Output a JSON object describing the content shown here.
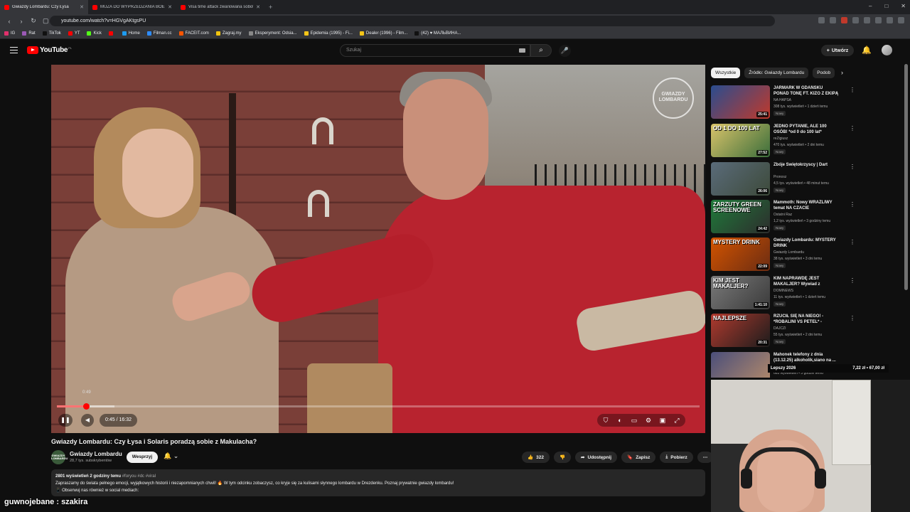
{
  "browser": {
    "tabs": [
      {
        "title": "Gwiazdy Lombardu: Czy Łysa",
        "active": true
      },
      {
        "title": "MUZA DO WYPRZEDZANIA BOEING",
        "active": false
      },
      {
        "title": "Visa time attack zwariowana sobota",
        "active": false
      }
    ],
    "new_tab": "+",
    "window_controls": [
      "–",
      "□",
      "✕"
    ],
    "url": "youtube.com/watch?v=HGVgAKtgsPU",
    "bookmarks": [
      {
        "label": "IG",
        "color": "#e1306c"
      },
      {
        "label": "Rat",
        "color": "#9b59b6"
      },
      {
        "label": "TikTok",
        "color": "#111111"
      },
      {
        "label": "YT",
        "color": "#ff0000"
      },
      {
        "label": "Kick",
        "color": "#53fc18"
      },
      {
        "label": "",
        "color": "#ff0000"
      },
      {
        "label": "Home",
        "color": "#1d9bf0"
      },
      {
        "label": "Filman.cc",
        "color": "#2d8cff"
      },
      {
        "label": "FACEIT.com",
        "color": "#ff5500"
      },
      {
        "label": "Zagraj.my",
        "color": "#f1c40f"
      },
      {
        "label": "Eksperyment: Odsia...",
        "color": "#888888"
      },
      {
        "label": "Epidemia (1995) - Fi...",
        "color": "#f5c518"
      },
      {
        "label": "Dealer (1996) - Film...",
        "color": "#f5c518"
      },
      {
        "label": "(42) ♥ МАЛЬВИНА...",
        "color": "#111111"
      }
    ]
  },
  "youtube": {
    "logo": "YouTube",
    "country": "PL",
    "search_placeholder": "Szukaj",
    "create_label": "Utwórz"
  },
  "video": {
    "watermark": "GWIAZDY LOMBARDU",
    "hover_time": "0:49",
    "time": "0:45 / 16:32",
    "progress_fraction": 0.045,
    "buffer_fraction": 0.09,
    "title": "Gwiazdy Lombardu: Czy Łysa i Solaris poradzą sobie z Makulacha?",
    "channel": "Gwiazdy Lombardu",
    "channel_avatar_text": "GWIAZDY LOMBARDU",
    "subs": "28,7 tys. subskrybentów",
    "support_label": "Wesprzyj",
    "likes": "322",
    "share_label": "Udostępnij",
    "save_label": "Zapisz",
    "download_label": "Pobierz",
    "desc_stats": "2801 wyświetleń  2 godziny temu",
    "desc_tags": "#foryou #dc #viral",
    "desc_line1": "Zapraszamy do świata pełnego emocji, wyjątkowych historii i niezapomnianych chwil! 🔥 W tym odcinku zobaczysz, co kryje się za kulisami słynnego lombardu w Drezdenku. Poznaj prywatnie gwiazdy lombardu!",
    "desc_line2": "📱 Obserwuj nas również w social mediach:"
  },
  "sidebar": {
    "chips": [
      "Wszystkie",
      "Źródło: Gwiazdy Lombardu",
      "Podob"
    ],
    "recs": [
      {
        "title": "JARMARK W GDAŃSKU PONAD TONĘ FT. KIZO Z EKIPĄ MTS",
        "channel": "NA HAPSA",
        "meta": "308 tys. wyświetleń • 1 dzień temu",
        "badge": "Nowy",
        "duration": "25:41",
        "thumb_text": "",
        "c1": "#2a4d8f",
        "c2": "#c0392b"
      },
      {
        "title": "JEDNO PYTANIE, ALE 100 OSÓB! *od 0 do 100 lat*",
        "channel": "reZigiusz",
        "meta": "470 tys. wyświetleń • 2 dni temu",
        "badge": "Nowy",
        "duration": "27:52",
        "thumb_text": "OD 1 DO 100 LAT",
        "c1": "#d9c36a",
        "c2": "#3b6e3b"
      },
      {
        "title": "Zbóje Świętokrzyscy | Dart",
        "channel": "Pronosz",
        "meta": "4,5 tys. wyświetleń • 48 minut temu",
        "badge": "Nowy",
        "duration": "26:06",
        "thumb_text": "",
        "c1": "#5a6b7a",
        "c2": "#3d4a3a"
      },
      {
        "title": "Mammoth: Nowy WRAŻLIWY temat NA CZACIE",
        "channel": "Ostatni Raz",
        "meta": "1,2 tys. wyświetleń • 3 godziny temu",
        "badge": "Nowy",
        "duration": "24:42",
        "thumb_text": "ZARZUTY GREEN SCREENOWE",
        "c1": "#1f7a3a",
        "c2": "#2d2d2d"
      },
      {
        "title": "Gwiazdy Lombardu: MYSTERY DRINK",
        "channel": "Gwiazdy Lombardu",
        "meta": "38 tys. wyświetleń • 3 dni temu",
        "badge": "Nowy",
        "duration": "22:09",
        "thumb_text": "MYSTERY DRINK",
        "c1": "#d35400",
        "c2": "#6b2c12"
      },
      {
        "title": "KIM NAPRAWDĘ JEST MAKALJER? Wywiad z Legend...",
        "channel": "DOMINEWS",
        "meta": "11 tys. wyświetleń • 1 dzień temu",
        "badge": "Nowy",
        "duration": "1:41:10",
        "thumb_text": "KIM JEST MAKALJER?",
        "c1": "#7a7a7a",
        "c2": "#3a3a3a"
      },
      {
        "title": "RZUCIŁ SIĘ NA NIEGO! - *ROBALINI VS PETEL* -",
        "channel": "DAJCZI",
        "meta": "55 tys. wyświetleń • 2 dni temu",
        "badge": "Nowy",
        "duration": "20:31",
        "thumb_text": "NAJLEPSZE",
        "c1": "#b03a2e",
        "c2": "#1c1c1c"
      },
      {
        "title": "Mahonek telefony z dnia (13.12.25) alkoholik,siano na ...",
        "channel": "",
        "meta": "683 wyświetleń • 5 godzin temu",
        "badge": "",
        "duration": "",
        "thumb_text": "",
        "c1": "#4b4f7a",
        "c2": "#b58b6a"
      }
    ]
  },
  "overlays": {
    "price_left": "Lepszy 2026",
    "price_right": "7,22 zł  •  67,00 zł",
    "chat_user": "guwnojebane",
    "chat_sep": " : ",
    "chat_msg": "szakira"
  },
  "colors": {
    "accent": "#ff0000",
    "bg": "#0f0f0f",
    "chip": "#272727"
  }
}
